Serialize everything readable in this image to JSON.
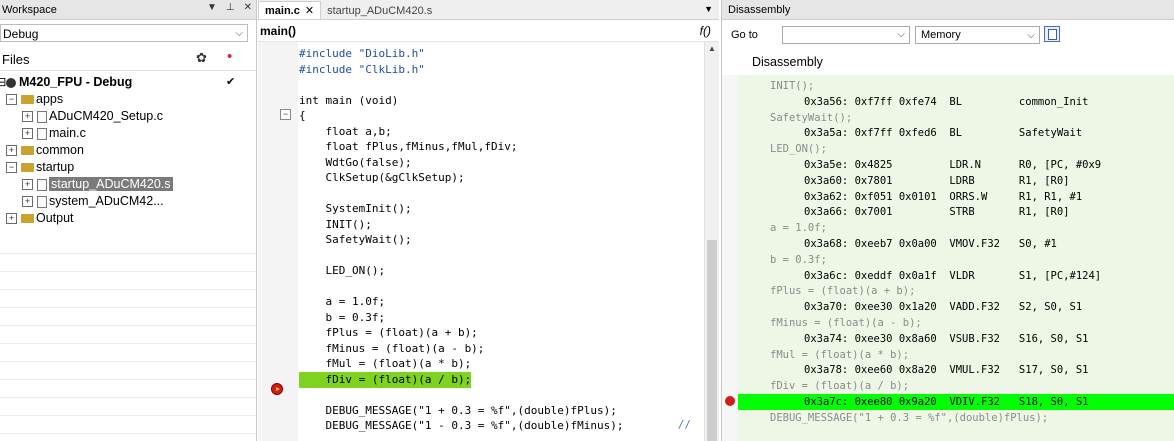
{
  "workspace": {
    "title": "Workspace",
    "config": "Debug",
    "files_label": "Files",
    "project": "M420_FPU - Debug",
    "tree": [
      {
        "label": "apps",
        "type": "folder",
        "level": 1,
        "sign": "⊟"
      },
      {
        "label": "ADuCM420_Setup.c",
        "type": "file",
        "level": 2,
        "sign": "⊞"
      },
      {
        "label": "main.c",
        "type": "file",
        "level": 2,
        "sign": "⊞"
      },
      {
        "label": "common",
        "type": "folder",
        "level": 1,
        "sign": "⊞"
      },
      {
        "label": "startup",
        "type": "folder",
        "level": 1,
        "sign": "⊟"
      },
      {
        "label": "startup_ADuCM420.s",
        "type": "file",
        "level": 2,
        "sign": "⊞",
        "selected": true
      },
      {
        "label": "system_ADuCM42...",
        "type": "file",
        "level": 2,
        "sign": "⊞"
      },
      {
        "label": "Output",
        "type": "folder",
        "level": 1,
        "sign": "⊞"
      }
    ]
  },
  "editor": {
    "tabs": [
      "main.c",
      "startup_ADuCM420.s"
    ],
    "function_bar": "main()",
    "function_icon": "f()",
    "lines": [
      "#include \"DioLib.h\"",
      "#include \"ClkLib.h\"",
      "",
      "int main (void)",
      "{",
      "    float a,b;",
      "    float fPlus,fMinus,fMul,fDiv;",
      "    WdtGo(false);",
      "    ClkSetup(&gClkSetup);",
      "",
      "    SystemInit();",
      "    INIT();",
      "    SafetyWait();",
      "",
      "    LED_ON();",
      "",
      "    a = 1.0f;",
      "    b = 0.3f;",
      "    fPlus = (float)(a + b);",
      "    fMinus = (float)(a - b);",
      "    fMul = (float)(a * b);",
      "    fDiv = (float)(a / b);",
      "",
      "    DEBUG_MESSAGE(\"1 + 0.3 = %f\",(double)fPlus);",
      "    DEBUG_MESSAGE(\"1 - 0.3 = %f\",(double)fMinus);"
    ],
    "comment_mark": "//"
  },
  "disassembly": {
    "title": "Disassembly",
    "goto_label": "Go to",
    "memory_label": "Memory",
    "heading": "Disassembly",
    "lines": [
      {
        "kind": "src",
        "text": "INIT();"
      },
      {
        "kind": "ins",
        "text": "0x3a56: 0xf7ff 0xfe74  BL         common_Init"
      },
      {
        "kind": "src",
        "text": "SafetyWait();"
      },
      {
        "kind": "ins",
        "text": "0x3a5a: 0xf7ff 0xfed6  BL         SafetyWait"
      },
      {
        "kind": "src",
        "text": "LED_ON();"
      },
      {
        "kind": "ins",
        "text": "0x3a5e: 0x4825         LDR.N      R0, [PC, #0x9"
      },
      {
        "kind": "ins",
        "text": "0x3a60: 0x7801         LDRB       R1, [R0]"
      },
      {
        "kind": "ins",
        "text": "0x3a62: 0xf051 0x0101  ORRS.W     R1, R1, #1"
      },
      {
        "kind": "ins",
        "text": "0x3a66: 0x7001         STRB       R1, [R0]"
      },
      {
        "kind": "src",
        "text": "a = 1.0f;"
      },
      {
        "kind": "ins",
        "text": "0x3a68: 0xeeb7 0x0a00  VMOV.F32   S0, #1"
      },
      {
        "kind": "src",
        "text": "b = 0.3f;"
      },
      {
        "kind": "ins",
        "text": "0x3a6c: 0xeddf 0x0a1f  VLDR       S1, [PC,#124]"
      },
      {
        "kind": "src",
        "text": "fPlus = (float)(a + b);"
      },
      {
        "kind": "ins",
        "text": "0x3a70: 0xee30 0x1a20  VADD.F32   S2, S0, S1"
      },
      {
        "kind": "src",
        "text": "fMinus = (float)(a - b);"
      },
      {
        "kind": "ins",
        "text": "0x3a74: 0xee30 0x8a60  VSUB.F32   S16, S0, S1"
      },
      {
        "kind": "src",
        "text": "fMul = (float)(a * b);"
      },
      {
        "kind": "ins",
        "text": "0x3a78: 0xee60 0x8a20  VMUL.F32   S17, S0, S1"
      },
      {
        "kind": "src",
        "text": "fDiv = (float)(a / b);"
      },
      {
        "kind": "ins",
        "text": "0x3a7c: 0xee80 0x9a20  VDIV.F32   S18, S0, S1",
        "current": true
      },
      {
        "kind": "src",
        "text": "DEBUG_MESSAGE(\"1 + 0.3 = %f\",(double)fPlus);"
      }
    ]
  }
}
